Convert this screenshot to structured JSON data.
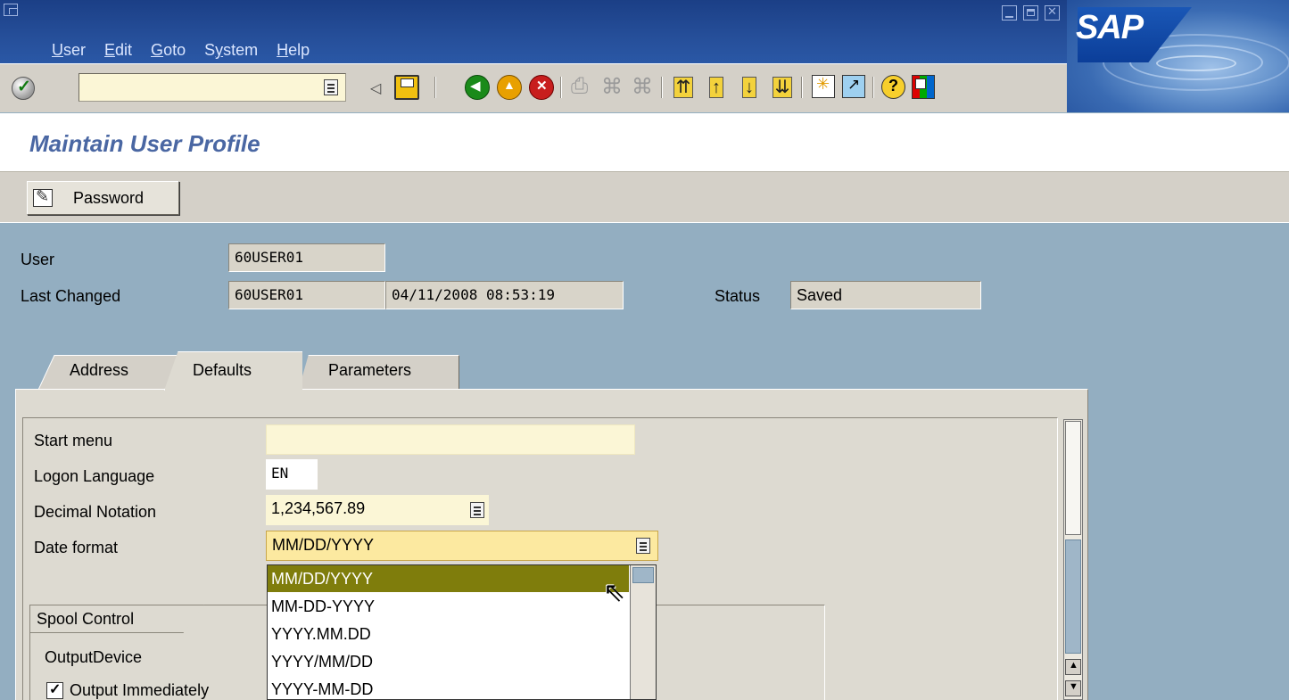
{
  "menu": [
    {
      "accel": "U",
      "rest": "ser"
    },
    {
      "accel": "E",
      "rest": "dit"
    },
    {
      "accel": "G",
      "rest": "oto"
    },
    {
      "pre": "S",
      "accel": "y",
      "rest": "stem"
    },
    {
      "accel": "H",
      "rest": "elp"
    }
  ],
  "branding": {
    "logo_text": "SAP"
  },
  "icons": {
    "enter": "check-icon",
    "save": "floppy-icon",
    "back": "back-arrow-icon",
    "exit": "exit-icon",
    "cancel": "cancel-icon",
    "print": "print-icon",
    "find": "find-icon",
    "find_next": "find-next-icon",
    "first_page": "first-page-icon",
    "prev_page": "prev-page-icon",
    "next_page": "next-page-icon",
    "last_page": "last-page-icon",
    "new_session": "new-session-icon",
    "shortcut": "shortcut-icon",
    "help": "help-icon",
    "layout": "layout-menu-icon"
  },
  "colors": {
    "title": "#4a67a3",
    "selection": "#7f7d0c",
    "field_bg": "#fbf6d6"
  },
  "page_title": "Maintain User Profile",
  "app_toolbar": {
    "password_label": "Password"
  },
  "header": {
    "user_label": "User",
    "user_value": "60USER01",
    "last_changed_label": "Last Changed",
    "last_changed_by": "60USER01",
    "last_changed_datetime": "04/11/2008 08:53:19",
    "status_label": "Status",
    "status_value": "Saved"
  },
  "tabs": [
    {
      "label": "Address",
      "active": false
    },
    {
      "label": "Defaults",
      "active": true
    },
    {
      "label": "Parameters",
      "active": false
    }
  ],
  "defaults": {
    "start_menu_label": "Start menu",
    "start_menu_value": "",
    "logon_language_label": "Logon Language",
    "logon_language_value": "EN",
    "decimal_label": "Decimal Notation",
    "decimal_value": "1,234,567.89",
    "date_format_label": "Date format",
    "date_format_value": "MM/DD/YYYY"
  },
  "date_format_options": [
    "MM/DD/YYYY",
    "MM-DD-YYYY",
    "YYYY.MM.DD",
    "YYYY/MM/DD",
    "YYYY-MM-DD"
  ],
  "spool": {
    "title": "Spool Control",
    "output_device_label": "OutputDevice",
    "output_immediately_label": "Output Immediately",
    "output_immediately_checked": true
  }
}
